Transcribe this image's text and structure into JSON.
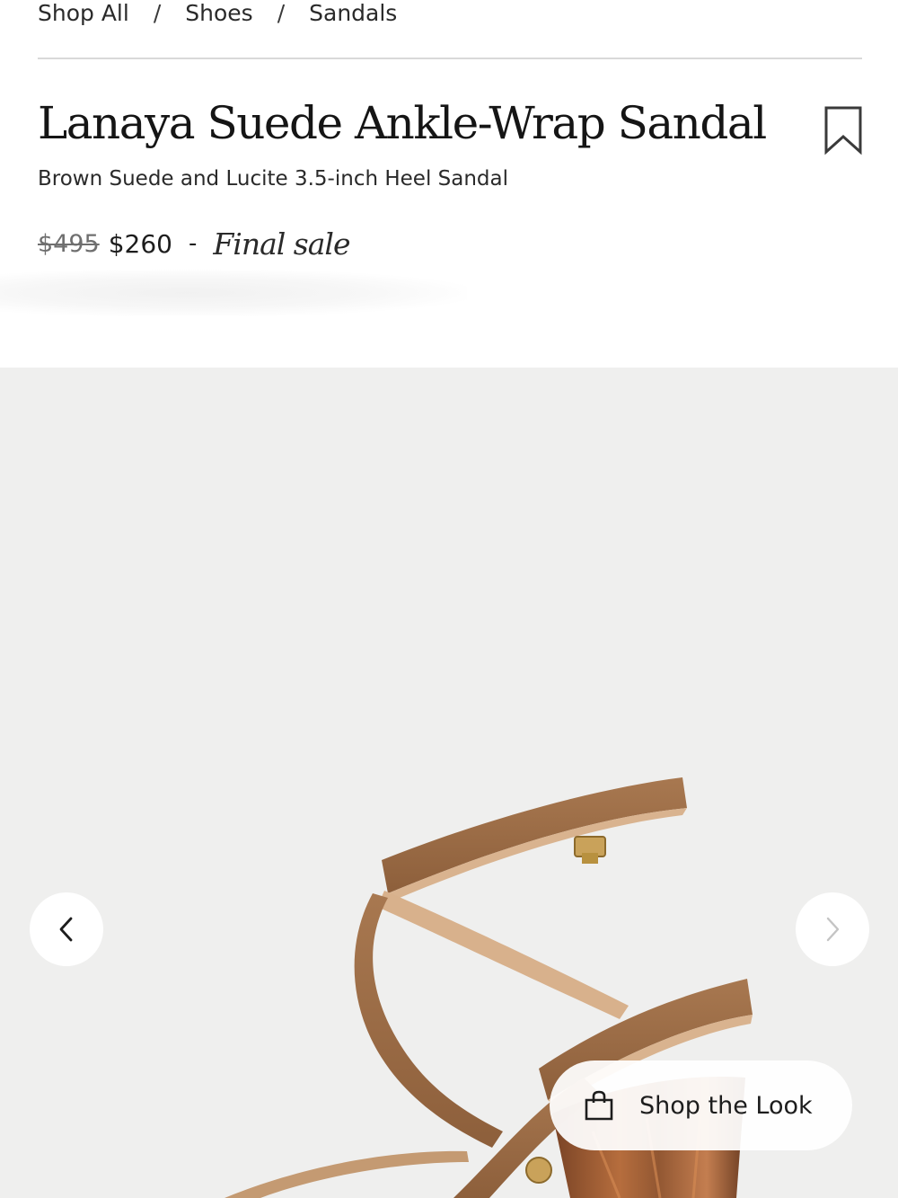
{
  "breadcrumb": {
    "items": [
      "Shop All",
      "Shoes",
      "Sandals"
    ],
    "separator": "/"
  },
  "product": {
    "title": "Lanaya Suede Ankle-Wrap Sandal",
    "subtitle": "Brown Suede and Lucite 3.5-inch Heel Sandal",
    "original_price": "$495",
    "sale_price": "$260",
    "dash": "-",
    "sale_note": "Final sale"
  },
  "gallery": {
    "shop_the_look_label": "Shop the Look",
    "prev_icon": "chevron-left-icon",
    "next_icon": "chevron-right-icon"
  },
  "icons": {
    "bookmark": "bookmark-icon",
    "shopping_bag": "shopping-bag-icon"
  },
  "colors": {
    "gallery_background": "#efefee",
    "suede": "#9a6a44",
    "lucite": "#8a4a22",
    "text": "#1d1d1d"
  }
}
